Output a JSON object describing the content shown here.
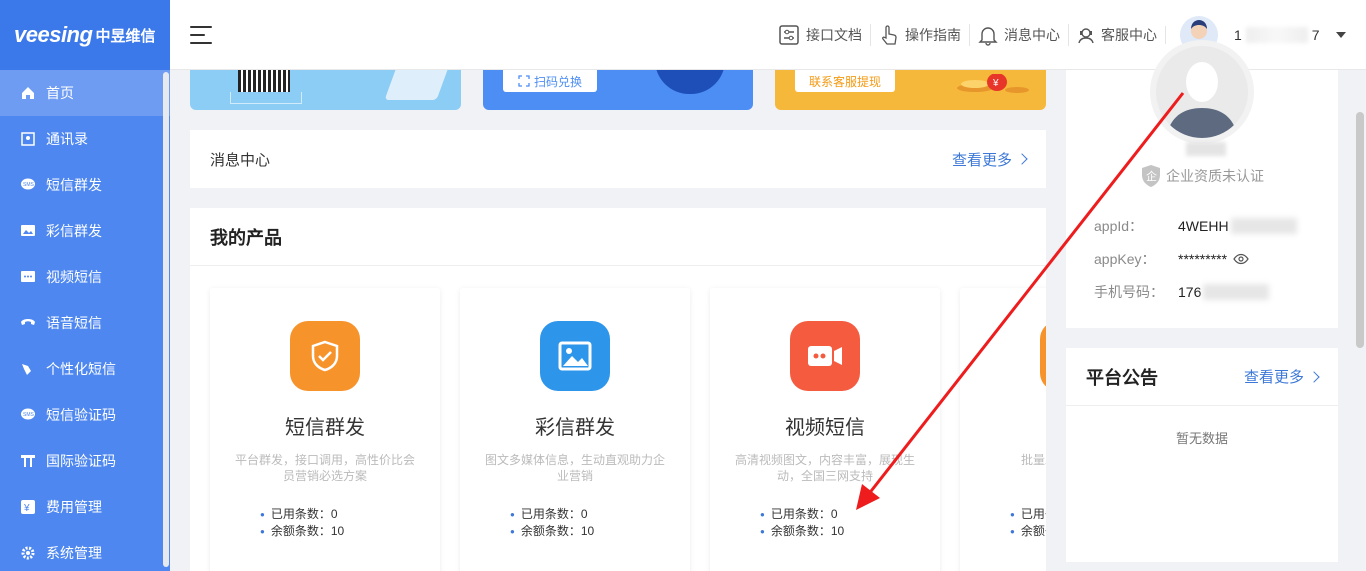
{
  "logo": {
    "brand": "veesing",
    "brand_cn": "中昱维信"
  },
  "sidebar": {
    "items": [
      {
        "label": "首页",
        "icon": "home-icon",
        "active": true
      },
      {
        "label": "通讯录",
        "icon": "contacts-icon"
      },
      {
        "label": "短信群发",
        "icon": "sms-icon"
      },
      {
        "label": "彩信群发",
        "icon": "image-message-icon"
      },
      {
        "label": "视频短信",
        "icon": "video-message-icon"
      },
      {
        "label": "语音短信",
        "icon": "phone-icon"
      },
      {
        "label": "个性化短信",
        "icon": "personalized-icon"
      },
      {
        "label": "短信验证码",
        "icon": "sms-code-icon"
      },
      {
        "label": "国际验证码",
        "icon": "international-icon"
      },
      {
        "label": "费用管理",
        "icon": "yen-icon"
      },
      {
        "label": "系统管理",
        "icon": "settings-icon"
      }
    ]
  },
  "header": {
    "links": [
      {
        "label": "接口文档",
        "icon": "api-doc-icon"
      },
      {
        "label": "操作指南",
        "icon": "hand-pointer-icon"
      },
      {
        "label": "消息中心",
        "icon": "bell-icon"
      },
      {
        "label": "客服中心",
        "icon": "customer-service-icon"
      }
    ],
    "user_prefix": "1",
    "user_suffix": "7"
  },
  "banners": {
    "scan_exchange": "扫码兑换",
    "contact_withdraw": "联系客服提现"
  },
  "messages": {
    "title": "消息中心",
    "more": "查看更多"
  },
  "products": {
    "title": "我的产品",
    "items": [
      {
        "name": "短信群发",
        "desc": "平台群发，接口调用，高性价比会员营销必选方案",
        "used": "已用条数：0",
        "remain": "余额条数：10",
        "color": "#f7932b",
        "icon": "shield-check-icon"
      },
      {
        "name": "彩信群发",
        "desc": "图文多媒体信息，生动直观助力企业营销",
        "used": "已用条数：0",
        "remain": "余额条数：10",
        "color": "#2d95ea",
        "icon": "picture-icon"
      },
      {
        "name": "视频短信",
        "desc": "高清视频图文，内容丰富，展现生动，全国三网支持",
        "used": "已用条数：0",
        "remain": "余额条数：10",
        "color": "#f55b3f",
        "icon": "video-camera-icon"
      },
      {
        "name": "个",
        "desc": "批量发送一适用于工",
        "used": "已用条数",
        "remain": "余额条数",
        "color": "#f7932b",
        "icon": "product-icon"
      }
    ]
  },
  "profile": {
    "certification": "企业资质未认证",
    "appid_label": "appId：",
    "appid_value": "4WEHH",
    "appkey_label": "appKey：",
    "appkey_value": "*********",
    "phone_label": "手机号码：",
    "phone_value": "176"
  },
  "notice": {
    "title": "平台公告",
    "more": "查看更多",
    "empty": "暂无数据"
  },
  "colors": {
    "sidebar": "#4e87f0",
    "accent": "#3d78d8",
    "annotation_arrow": "#ee1c1c"
  }
}
